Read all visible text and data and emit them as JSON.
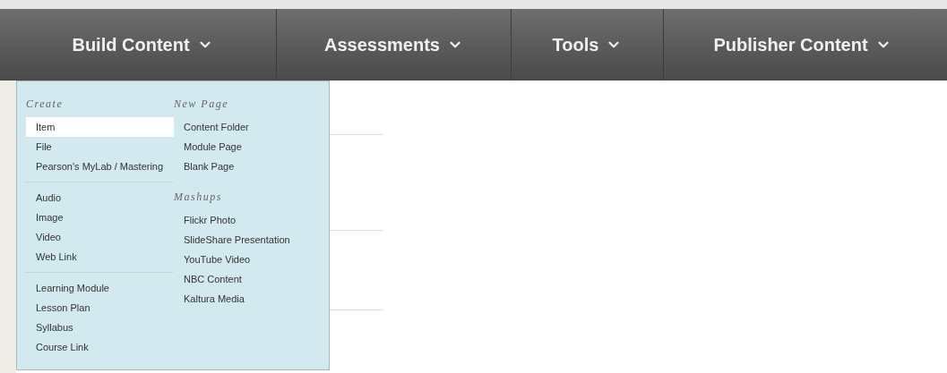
{
  "nav": [
    {
      "label": "Build Content"
    },
    {
      "label": "Assessments"
    },
    {
      "label": "Tools"
    },
    {
      "label": "Publisher Content"
    }
  ],
  "menu": {
    "columns": [
      {
        "groups": [
          {
            "heading": "Create",
            "items": [
              {
                "label": "Item",
                "selected": true
              },
              {
                "label": "File",
                "selected": false
              },
              {
                "label": "Pearson's MyLab / Mastering",
                "selected": false
              }
            ]
          },
          {
            "items": [
              {
                "label": "Audio",
                "selected": false
              },
              {
                "label": "Image",
                "selected": false
              },
              {
                "label": "Video",
                "selected": false
              },
              {
                "label": "Web Link",
                "selected": false
              }
            ]
          },
          {
            "items": [
              {
                "label": "Learning Module",
                "selected": false
              },
              {
                "label": "Lesson Plan",
                "selected": false
              },
              {
                "label": "Syllabus",
                "selected": false
              },
              {
                "label": "Course Link",
                "selected": false
              }
            ]
          }
        ]
      },
      {
        "groups": [
          {
            "heading": "New Page",
            "items": [
              {
                "label": "Content Folder",
                "selected": false
              },
              {
                "label": "Module Page",
                "selected": false
              },
              {
                "label": "Blank Page",
                "selected": false
              }
            ]
          },
          {
            "heading": "Mashups",
            "items": [
              {
                "label": "Flickr Photo",
                "selected": false
              },
              {
                "label": "SlideShare Presentation",
                "selected": false
              },
              {
                "label": "YouTube Video",
                "selected": false
              },
              {
                "label": "NBC Content",
                "selected": false
              },
              {
                "label": "Kaltura Media",
                "selected": false
              }
            ]
          }
        ]
      }
    ]
  }
}
